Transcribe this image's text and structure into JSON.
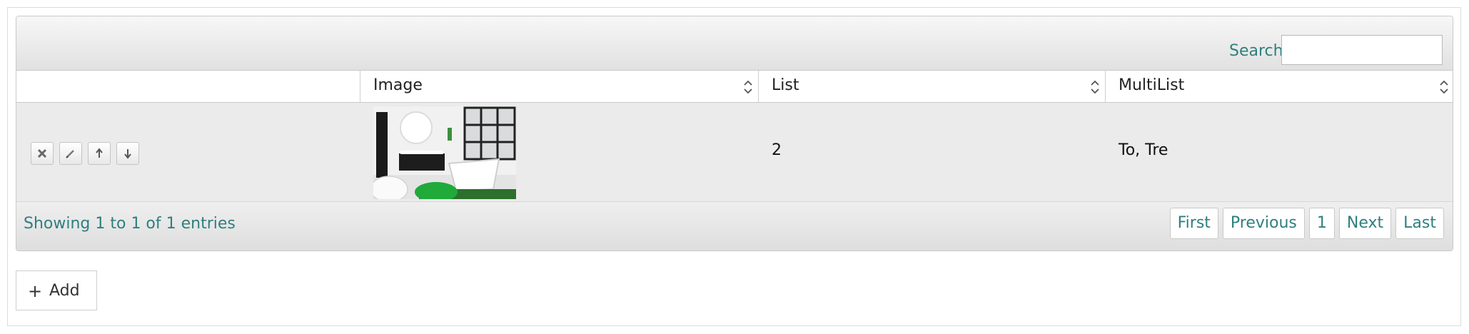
{
  "toolbar": {
    "search_label": "Search:",
    "search_value": ""
  },
  "table": {
    "columns": [
      {
        "label": ""
      },
      {
        "label": "Image"
      },
      {
        "label": "List"
      },
      {
        "label": "MultiList"
      }
    ],
    "rows": [
      {
        "image": "bathroom-thumbnail",
        "list": "2",
        "multilist": "To, Tre"
      }
    ]
  },
  "row_actions": [
    "delete-icon",
    "edit-icon",
    "arrow-up-icon",
    "arrow-down-icon"
  ],
  "footer": {
    "info": "Showing 1 to 1 of 1 entries",
    "pager": {
      "first": "First",
      "previous": "Previous",
      "page": "1",
      "next": "Next",
      "last": "Last"
    }
  },
  "add_button": {
    "icon": "plus-icon",
    "label": "Add"
  },
  "colors": {
    "accent": "#2f7f7e",
    "row_bg": "#ebebeb"
  }
}
